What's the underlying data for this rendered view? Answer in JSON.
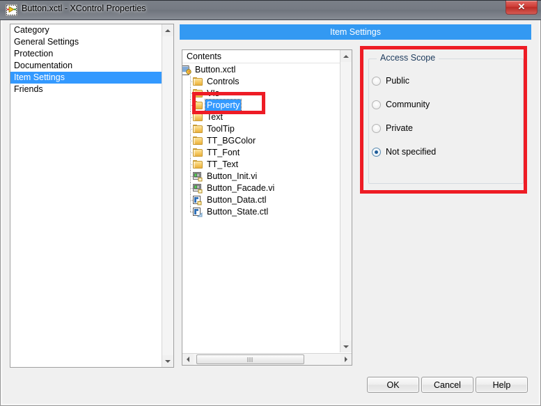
{
  "window": {
    "title": "Button.xctl - XControl Properties",
    "title_icon": "xcontrol-icon",
    "close_label": "✕",
    "accent_color": "#3399f2",
    "annotation_color": "#ee1c25"
  },
  "category_panel": {
    "header": "Category",
    "items": [
      {
        "label": "General Settings",
        "selected": false
      },
      {
        "label": "Protection",
        "selected": false
      },
      {
        "label": "Documentation",
        "selected": false
      },
      {
        "label": "Item Settings",
        "selected": true
      },
      {
        "label": "Friends",
        "selected": false
      }
    ],
    "scrollbar": {
      "up_icon": "scroll-up-arrow",
      "down_icon": "scroll-down-arrow"
    }
  },
  "banner": {
    "title": "Item Settings"
  },
  "contents_panel": {
    "header": "Contents",
    "tree": [
      {
        "label": "Button.xctl",
        "depth": 0,
        "expander": "minus",
        "icon": "xcontrol-icon",
        "selected": false
      },
      {
        "label": "Controls",
        "depth": 1,
        "expander": "plus",
        "icon": "folder-icon",
        "selected": false
      },
      {
        "label": "VIs",
        "depth": 1,
        "expander": "plus",
        "icon": "folder-icon",
        "selected": false
      },
      {
        "label": "Property",
        "depth": 1,
        "expander": "plus",
        "icon": "folder-icon",
        "selected": true
      },
      {
        "label": "Text",
        "depth": 1,
        "expander": "plus",
        "icon": "folder-icon",
        "selected": false
      },
      {
        "label": "ToolTip",
        "depth": 1,
        "expander": "plus",
        "icon": "folder-icon",
        "selected": false
      },
      {
        "label": "TT_BGColor",
        "depth": 1,
        "expander": "plus",
        "icon": "folder-icon",
        "selected": false
      },
      {
        "label": "TT_Font",
        "depth": 1,
        "expander": "plus",
        "icon": "folder-icon",
        "selected": false
      },
      {
        "label": "TT_Text",
        "depth": 1,
        "expander": "plus",
        "icon": "folder-icon",
        "selected": false
      },
      {
        "label": "Button_Init.vi",
        "depth": 1,
        "expander": "none",
        "icon": "vi-icon",
        "selected": false
      },
      {
        "label": "Button_Facade.vi",
        "depth": 1,
        "expander": "none",
        "icon": "vi-icon",
        "selected": false
      },
      {
        "label": "Button_Data.ctl",
        "depth": 1,
        "expander": "none",
        "icon": "ctl-icon",
        "selected": false
      },
      {
        "label": "Button_State.ctl",
        "depth": 1,
        "expander": "none",
        "icon": "ctl-state-icon",
        "selected": false
      }
    ],
    "scrollbars": {
      "vertical": {
        "up_icon": "scroll-up-arrow",
        "down_icon": "scroll-down-arrow"
      },
      "horizontal": {
        "left_icon": "scroll-left-arrow",
        "right_icon": "scroll-right-arrow"
      }
    }
  },
  "access_scope": {
    "legend": "Access Scope",
    "options": [
      {
        "label": "Public",
        "selected": false
      },
      {
        "label": "Community",
        "selected": false
      },
      {
        "label": "Private",
        "selected": false
      },
      {
        "label": "Not specified",
        "selected": true
      }
    ]
  },
  "buttons": {
    "ok": "OK",
    "cancel": "Cancel",
    "help": "Help"
  }
}
